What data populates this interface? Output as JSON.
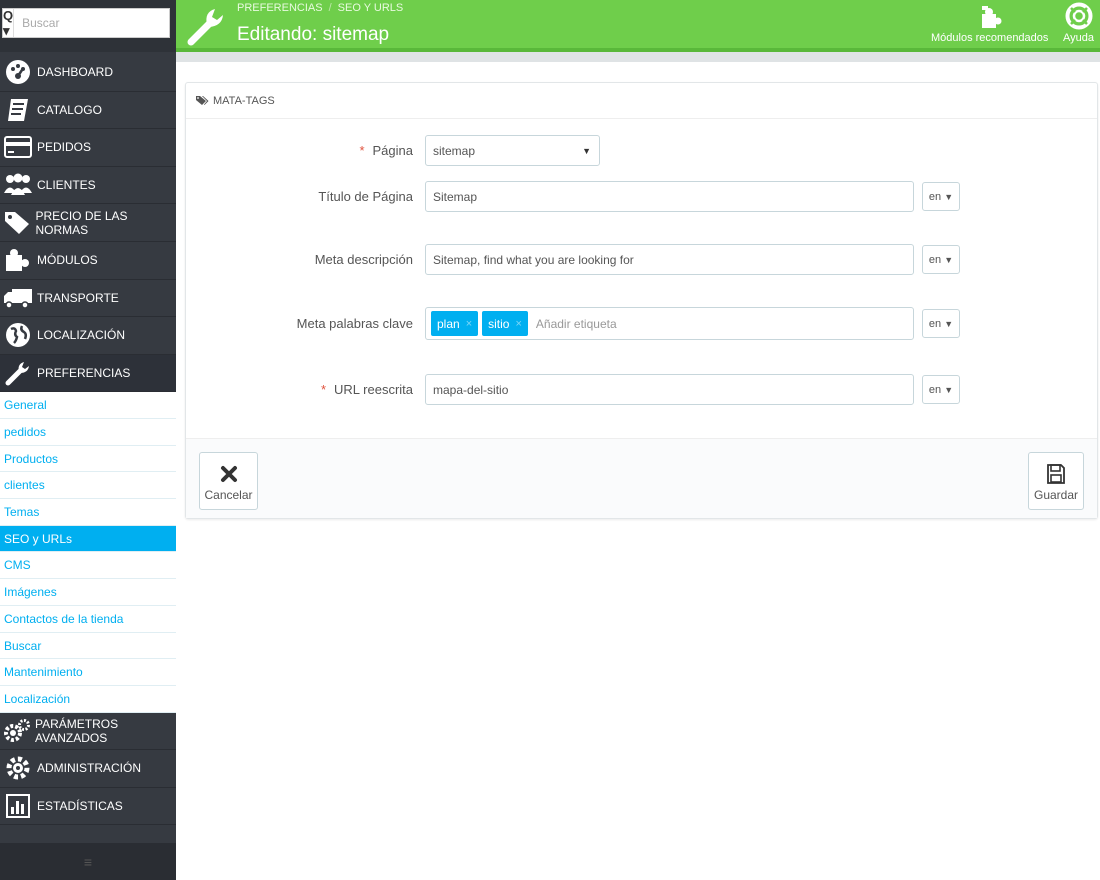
{
  "search": {
    "placeholder": "Buscar",
    "button_label": "Q ▾"
  },
  "sidebar": {
    "items": [
      {
        "label": "DASHBOARD",
        "icon": "dashboard-icon"
      },
      {
        "label": "CATALOGO",
        "icon": "catalog-icon"
      },
      {
        "label": "PEDIDOS",
        "icon": "credit-card-icon"
      },
      {
        "label": "CLIENTES",
        "icon": "users-icon"
      },
      {
        "label": "PRECIO DE LAS NORMAS",
        "icon": "tags-icon"
      },
      {
        "label": "MÓDULOS",
        "icon": "puzzle-icon"
      },
      {
        "label": "TRANSPORTE",
        "icon": "truck-icon"
      },
      {
        "label": "LOCALIZACIÓN",
        "icon": "globe-icon"
      },
      {
        "label": "PREFERENCIAS",
        "icon": "wrench-icon"
      }
    ],
    "sub_items": [
      "General",
      "pedidos",
      "Productos",
      "clientes",
      "Temas",
      "SEO y URLs",
      "CMS",
      "Imágenes",
      "Contactos de la tienda",
      "Buscar",
      "Mantenimiento",
      "Localización"
    ],
    "bottom_items": [
      {
        "label": "PARÁMETROS AVANZADOS",
        "icon": "cogs-icon"
      },
      {
        "label": "ADMINISTRACIÓN",
        "icon": "cog-icon"
      },
      {
        "label": "ESTADÍSTICAS",
        "icon": "bar-chart-icon"
      }
    ],
    "footer_glyph": "≡"
  },
  "header": {
    "breadcrumb": [
      "PREFERENCIAS",
      "SEO Y URLS"
    ],
    "breadcrumb_sep": "/",
    "title": "Editando: sitemap",
    "modules_label": "Módulos recomendados",
    "help_label": "Ayuda"
  },
  "form": {
    "heading": "MATA-TAGS",
    "required_mark": "*",
    "page_label": "Página",
    "page_value": "sitemap",
    "page_title_label": "Título de Página",
    "page_title_value": "Sitemap",
    "meta_desc_label": "Meta descripción",
    "meta_desc_value": "Sitemap, find what you are looking for",
    "meta_keywords_label": "Meta palabras clave",
    "keywords": [
      "plan",
      "sitio"
    ],
    "tag_remove": "×",
    "add_tag_placeholder": "Añadir etiqueta",
    "url_label": "URL reescrita",
    "url_value": "mapa-del-sitio",
    "lang": "en",
    "dropdown_arrow": "▼"
  },
  "footer": {
    "cancel_label": "Cancelar",
    "save_label": "Guardar"
  },
  "colors": {
    "header_green": "#6fce4b",
    "accent_blue": "#00aff0",
    "sidebar_dark": "#363a41",
    "required_red": "#e0523d"
  }
}
